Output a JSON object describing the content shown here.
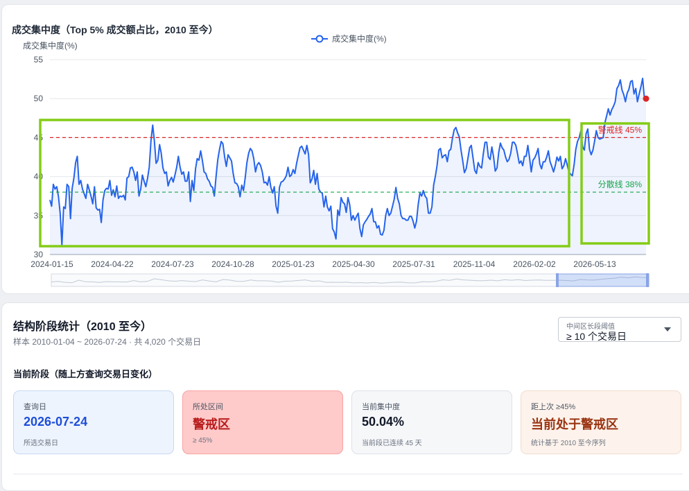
{
  "chart_card": {
    "title": "成交集中度（Top 5% 成交额占比，2010 至今）",
    "y_unit": "成交集中度(%)"
  },
  "chart_data": {
    "type": "line",
    "title": "成交集中度（Top 5% 成交额占比，2010 至今）",
    "ylabel": "成交集中度(%)",
    "xlabel": "",
    "ylim": [
      30,
      55
    ],
    "yticks": [
      30,
      35,
      40,
      45,
      50,
      55
    ],
    "x_tick_labels": [
      "2024-01-15",
      "2024-04-22",
      "2024-07-23",
      "2024-10-28",
      "2025-01-23",
      "2025-04-30",
      "2025-07-31",
      "2025-11-04",
      "2026-02-02",
      "2026-05-13"
    ],
    "series": [
      {
        "name": "成交集中度(%)",
        "color": "#2563eb",
        "values": [
          37.0,
          36.2,
          39.0,
          38.4,
          38.7,
          37.4,
          35.3,
          31.2,
          36.1,
          35.9,
          39.0,
          38.7,
          34.6,
          38.5,
          39.8,
          41.8,
          42.6,
          39.0,
          39.5,
          38.4,
          37.8,
          37.2,
          39.0,
          38.3,
          37.5,
          36.5,
          38.7,
          36.0,
          35.7,
          35.8,
          34.1,
          37.0,
          38.2,
          38.5,
          38.4,
          39.5,
          37.6,
          38.3,
          37.4,
          38.8,
          37.2,
          37.5,
          37.4,
          37.6,
          37.0,
          39.8,
          40.0,
          41.1,
          41.2,
          40.6,
          39.5,
          40.6,
          37.5,
          38.4,
          40.2,
          39.4,
          38.7,
          39.8,
          41.2,
          44.6,
          46.6,
          44.6,
          41.7,
          42.1,
          44.1,
          43.0,
          41.1,
          40.4,
          40.6,
          38.8,
          39.5,
          39.9,
          39.3,
          40.2,
          41.2,
          42.6,
          41.2,
          40.3,
          40.6,
          39.4,
          39.4,
          40.6,
          36.8,
          39.5,
          38.2,
          41.0,
          42.3,
          42.1,
          43.3,
          42.1,
          40.6,
          40.4,
          39.7,
          39.4,
          38.8,
          38.6,
          37.5,
          40.0,
          42.2,
          43.5,
          44.5,
          44.2,
          42.5,
          41.3,
          42.8,
          42.4,
          42.0,
          40.4,
          39.2,
          39.1,
          38.7,
          37.4,
          38.9,
          38.2,
          39.8,
          41.8,
          43.0,
          43.6,
          43.3,
          42.3,
          40.6,
          41.5,
          41.8,
          41.4,
          40.6,
          39.2,
          39.3,
          38.9,
          40.0,
          38.6,
          37.9,
          38.7,
          36.2,
          35.3,
          38.6,
          39.3,
          39.4,
          39.7,
          40.1,
          41.2,
          40.0,
          40.2,
          40.9,
          40.4,
          41.7,
          42.7,
          43.7,
          43.9,
          43.4,
          42.9,
          44.0,
          42.8,
          39.2,
          39.7,
          40.8,
          39.0,
          40.4,
          38.4,
          38.0,
          37.9,
          36.1,
          37.5,
          36.1,
          35.6,
          36.2,
          33.3,
          32.9,
          32.0,
          35.7,
          35.0,
          37.3,
          36.7,
          36.5,
          35.4,
          37.3,
          36.4,
          34.4,
          35.0,
          34.4,
          34.9,
          35.3,
          33.3,
          32.3,
          33.8,
          34.2,
          34.5,
          34.9,
          35.2,
          35.9,
          34.2,
          34.2,
          33.4,
          33.7,
          32.6,
          32.5,
          33.1,
          35.0,
          35.9,
          35.0,
          35.3,
          36.2,
          37.1,
          38.6,
          37.2,
          36.5,
          35.0,
          34.6,
          34.6,
          34.4,
          34.4,
          34.9,
          34.9,
          34.3,
          33.4,
          34.3,
          36.4,
          37.9,
          37.5,
          38.2,
          37.5,
          37.2,
          35.3,
          35.3,
          36.1,
          38.9,
          40.0,
          41.4,
          43.4,
          43.6,
          42.4,
          42.7,
          42.8,
          41.9,
          43.3,
          43.5,
          44.9,
          46.0,
          46.3,
          45.6,
          45.1,
          43.4,
          42.0,
          40.5,
          41.0,
          42.3,
          43.7,
          44.0,
          42.4,
          40.8,
          40.4,
          41.8,
          41.3,
          41.1,
          42.9,
          44.4,
          44.4,
          42.5,
          42.2,
          43.8,
          42.5,
          40.7,
          41.1,
          43.1,
          44.3,
          43.7,
          43.4,
          42.5,
          41.9,
          42.2,
          43.0,
          44.4,
          44.4,
          44.0,
          42.9,
          41.7,
          42.0,
          41.4,
          42.6,
          42.6,
          44.0,
          42.4,
          40.6,
          42.1,
          42.4,
          42.9,
          43.6,
          41.6,
          41.0,
          41.9,
          41.9,
          42.5,
          43.3,
          41.9,
          41.3,
          40.6,
          41.4,
          42.5,
          42.0,
          42.6,
          41.0,
          41.4,
          42.3,
          41.5,
          40.6,
          40.3,
          40.1,
          41.5,
          43.5,
          44.5,
          45.0,
          45.9,
          43.8,
          43.4,
          45.5,
          46.1,
          43.5,
          42.8,
          43.4,
          44.6,
          45.9,
          45.0,
          44.8,
          44.9,
          45.0,
          46.9,
          47.8,
          48.7,
          47.9,
          48.6,
          49.0,
          49.6,
          51.3,
          51.7,
          52.4,
          51.1,
          50.5,
          49.6,
          50.7,
          51.2,
          52.2,
          52.3,
          50.6,
          51.3,
          49.6,
          50.6,
          51.5,
          52.6,
          50.2,
          50.0
        ]
      }
    ],
    "end_marker_color": "#dc2626",
    "reference_lines": [
      {
        "label": "警戒线 45%",
        "value": 45,
        "color": "#dc2626"
      },
      {
        "label": "分散线 38%",
        "value": 38,
        "color": "#16a34a"
      }
    ],
    "highlight_color": "#84cc16",
    "grid": true
  },
  "stats": {
    "title": "结构阶段统计（2010 至今）",
    "subtitle": "样本 2010-01-04 ~ 2026-07-24 · 共 4,020 个交易日",
    "select": {
      "label": "中间区长段阈值",
      "value": "≥ 10 个交易日"
    },
    "section_label": "当前阶段（随上方查询交易日变化）",
    "boxes": [
      {
        "key": "查询日",
        "value": "2026-07-24",
        "note": "所选交易日"
      },
      {
        "key": "所处区间",
        "value": "警戒区",
        "note": "≥ 45%"
      },
      {
        "key": "当前集中度",
        "value": "50.04%",
        "note": "当前段已连续 45 天"
      },
      {
        "key": "距上次 ≥45%",
        "value": "当前处于警戒区",
        "note": "统计基于 2010 至今序列"
      }
    ]
  }
}
